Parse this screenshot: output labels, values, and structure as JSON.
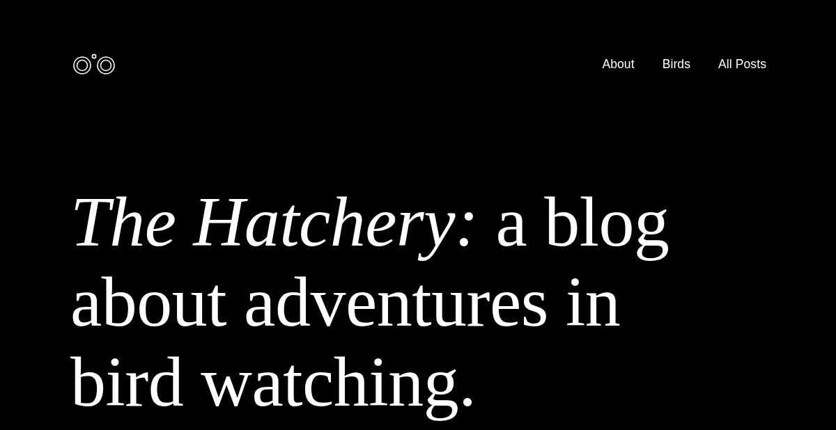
{
  "header": {
    "nav": [
      {
        "label": "About"
      },
      {
        "label": "Birds"
      },
      {
        "label": "All Posts"
      }
    ]
  },
  "hero": {
    "heading": "*The Hatchery:* a blog about adventures in bird watching."
  }
}
